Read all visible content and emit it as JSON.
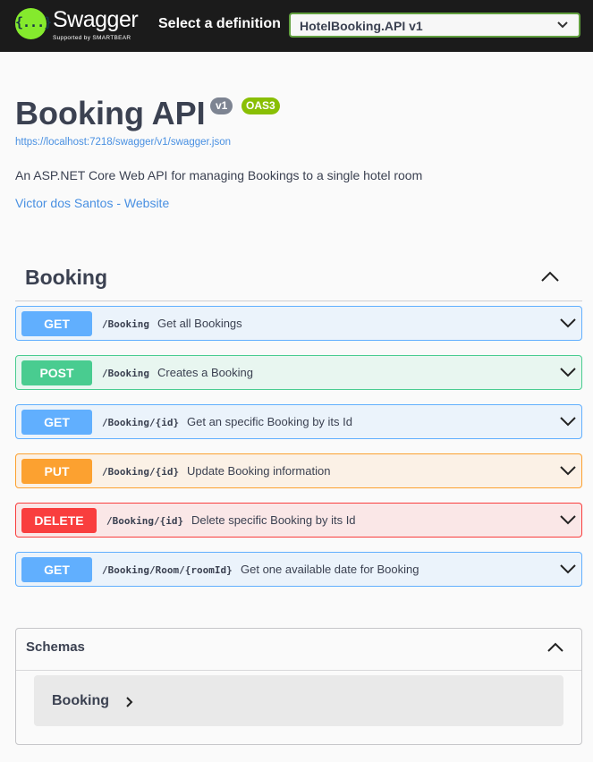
{
  "topbar": {
    "logo_symbol": "{...}",
    "logo_name": "Swagger",
    "logo_subtitle": "Supported by SMARTBEAR",
    "select_label": "Select a definition",
    "selected_definition": "HotelBooking.API v1",
    "accent_color": "#85ea2d"
  },
  "info": {
    "title": "Booking API",
    "version_badge": "v1",
    "oas_badge": "OAS3",
    "spec_url": "https://localhost:7218/swagger/v1/swagger.json",
    "description": "An ASP.NET Core Web API for managing Bookings to a single hotel room",
    "contact_link": "Victor dos Santos - Website"
  },
  "tag": {
    "name": "Booking",
    "expanded": true
  },
  "operations": [
    {
      "method": "GET",
      "path": "/Booking",
      "summary": "Get all Bookings",
      "color": "#61affe"
    },
    {
      "method": "POST",
      "path": "/Booking",
      "summary": "Creates a Booking",
      "color": "#49cc90"
    },
    {
      "method": "GET",
      "path": "/Booking/{id}",
      "summary": "Get an specific Booking by its Id",
      "color": "#61affe"
    },
    {
      "method": "PUT",
      "path": "/Booking/{id}",
      "summary": "Update Booking information",
      "color": "#fca130"
    },
    {
      "method": "DELETE",
      "path": "/Booking/{id}",
      "summary": "Delete specific Booking by its Id",
      "color": "#f93e3e"
    },
    {
      "method": "GET",
      "path": "/Booking/Room/{roomId}",
      "summary": "Get one available date for Booking",
      "color": "#61affe"
    }
  ],
  "schemas": {
    "title": "Schemas",
    "expanded": true,
    "models": [
      {
        "name": "Booking",
        "icon": "chevron-right-icon"
      }
    ]
  }
}
